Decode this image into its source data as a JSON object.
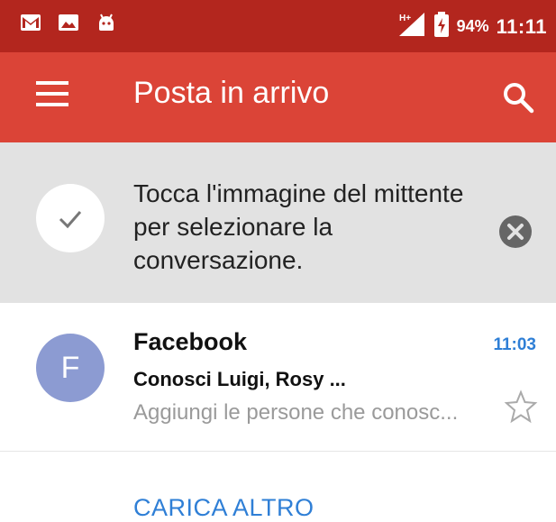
{
  "status_bar": {
    "icons": [
      "gmail-notification-icon",
      "image-notification-icon",
      "android-icon",
      "network-signal-icon",
      "battery-charging-icon"
    ],
    "battery_percent": "94%",
    "time": "11:11"
  },
  "app_bar": {
    "title": "Posta in arrivo",
    "menu_icon": "menu-icon",
    "search_icon": "search-icon"
  },
  "tip": {
    "text": "Tocca l'immagine del mittente per selezionare la conversazione.",
    "check_icon": "check-icon",
    "close_icon": "close-circle-icon"
  },
  "inbox": {
    "conversations": [
      {
        "avatar_letter": "F",
        "avatar_color": "#8c9bd2",
        "sender": "Facebook",
        "time": "11:03",
        "subject": "Conosci Luigi, Rosy ...",
        "snippet": "Aggiungi le persone che conosc...",
        "starred": false
      }
    ],
    "load_more_label": "CARICA ALTRO"
  },
  "colors": {
    "status_bar": "#b3261e",
    "app_bar": "#db4437",
    "tip_background": "#e2e2e2",
    "accent_blue": "#2f7fd6"
  }
}
